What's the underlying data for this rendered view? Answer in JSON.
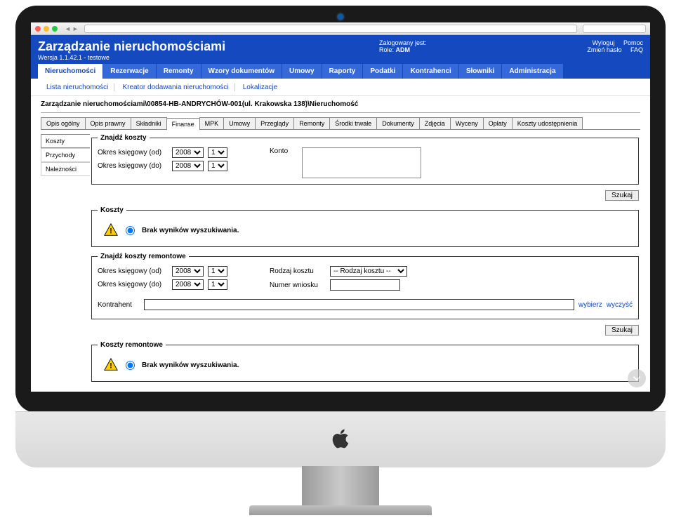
{
  "header": {
    "title": "Zarządzanie nieruchomościami",
    "version": "Wersja 1.1.42.1 - testowe",
    "logged_label": "Zalogowany jest:",
    "role_label": "Role:",
    "role_value": "ADM",
    "links": {
      "logout": "Wyloguj",
      "change_pw": "Zmień hasło",
      "help": "Pomoc",
      "faq": "FAQ"
    }
  },
  "main_nav": [
    "Nieruchomości",
    "Rezerwacje",
    "Remonty",
    "Wzory dokumentów",
    "Umowy",
    "Raporty",
    "Podatki",
    "Kontrahenci",
    "Słowniki",
    "Administracja"
  ],
  "main_nav_active": 0,
  "subnav": [
    "Lista nieruchomości",
    "Kreator dodawania nieruchomości",
    "Lokalizacje"
  ],
  "breadcrumb": "Zarządzanie nieruchomościami\\00854-HB-ANDRYCHÓW-001(ul. Krakowska 138)\\Nieruchomość",
  "inner_tabs": [
    "Opis ogólny",
    "Opis prawny",
    "Składniki",
    "Finanse",
    "MPK",
    "Umowy",
    "Przeglądy",
    "Remonty",
    "Środki trwałe",
    "Dokumenty",
    "Zdjęcia",
    "Wyceny",
    "Opłaty",
    "Koszty udostępnienia"
  ],
  "inner_tabs_active": 3,
  "side_menu": [
    "Koszty",
    "Przychody",
    "Należności"
  ],
  "side_menu_active": 0,
  "search1": {
    "legend": "Znajdź koszty",
    "from_label": "Okres księgowy (od)",
    "to_label": "Okres księgowy (do)",
    "year": "2008",
    "month": "1",
    "konto_label": "Konto",
    "search_btn": "Szukaj"
  },
  "results1": {
    "legend": "Koszty",
    "message": "Brak wyników wyszukiwania."
  },
  "search2": {
    "legend": "Znajdź koszty remontowe",
    "from_label": "Okres księgowy (od)",
    "to_label": "Okres księgowy (do)",
    "year": "2008",
    "month": "1",
    "cost_type_label": "Rodzaj kosztu",
    "cost_type_value": "-- Rodzaj kosztu --",
    "request_no_label": "Numer wniosku",
    "contractor_label": "Kontrahent",
    "select_link": "wybierz",
    "clear_link": "wyczyść",
    "search_btn": "Szukaj"
  },
  "results2": {
    "legend": "Koszty remontowe",
    "message": "Brak wyników wyszukiwania."
  }
}
